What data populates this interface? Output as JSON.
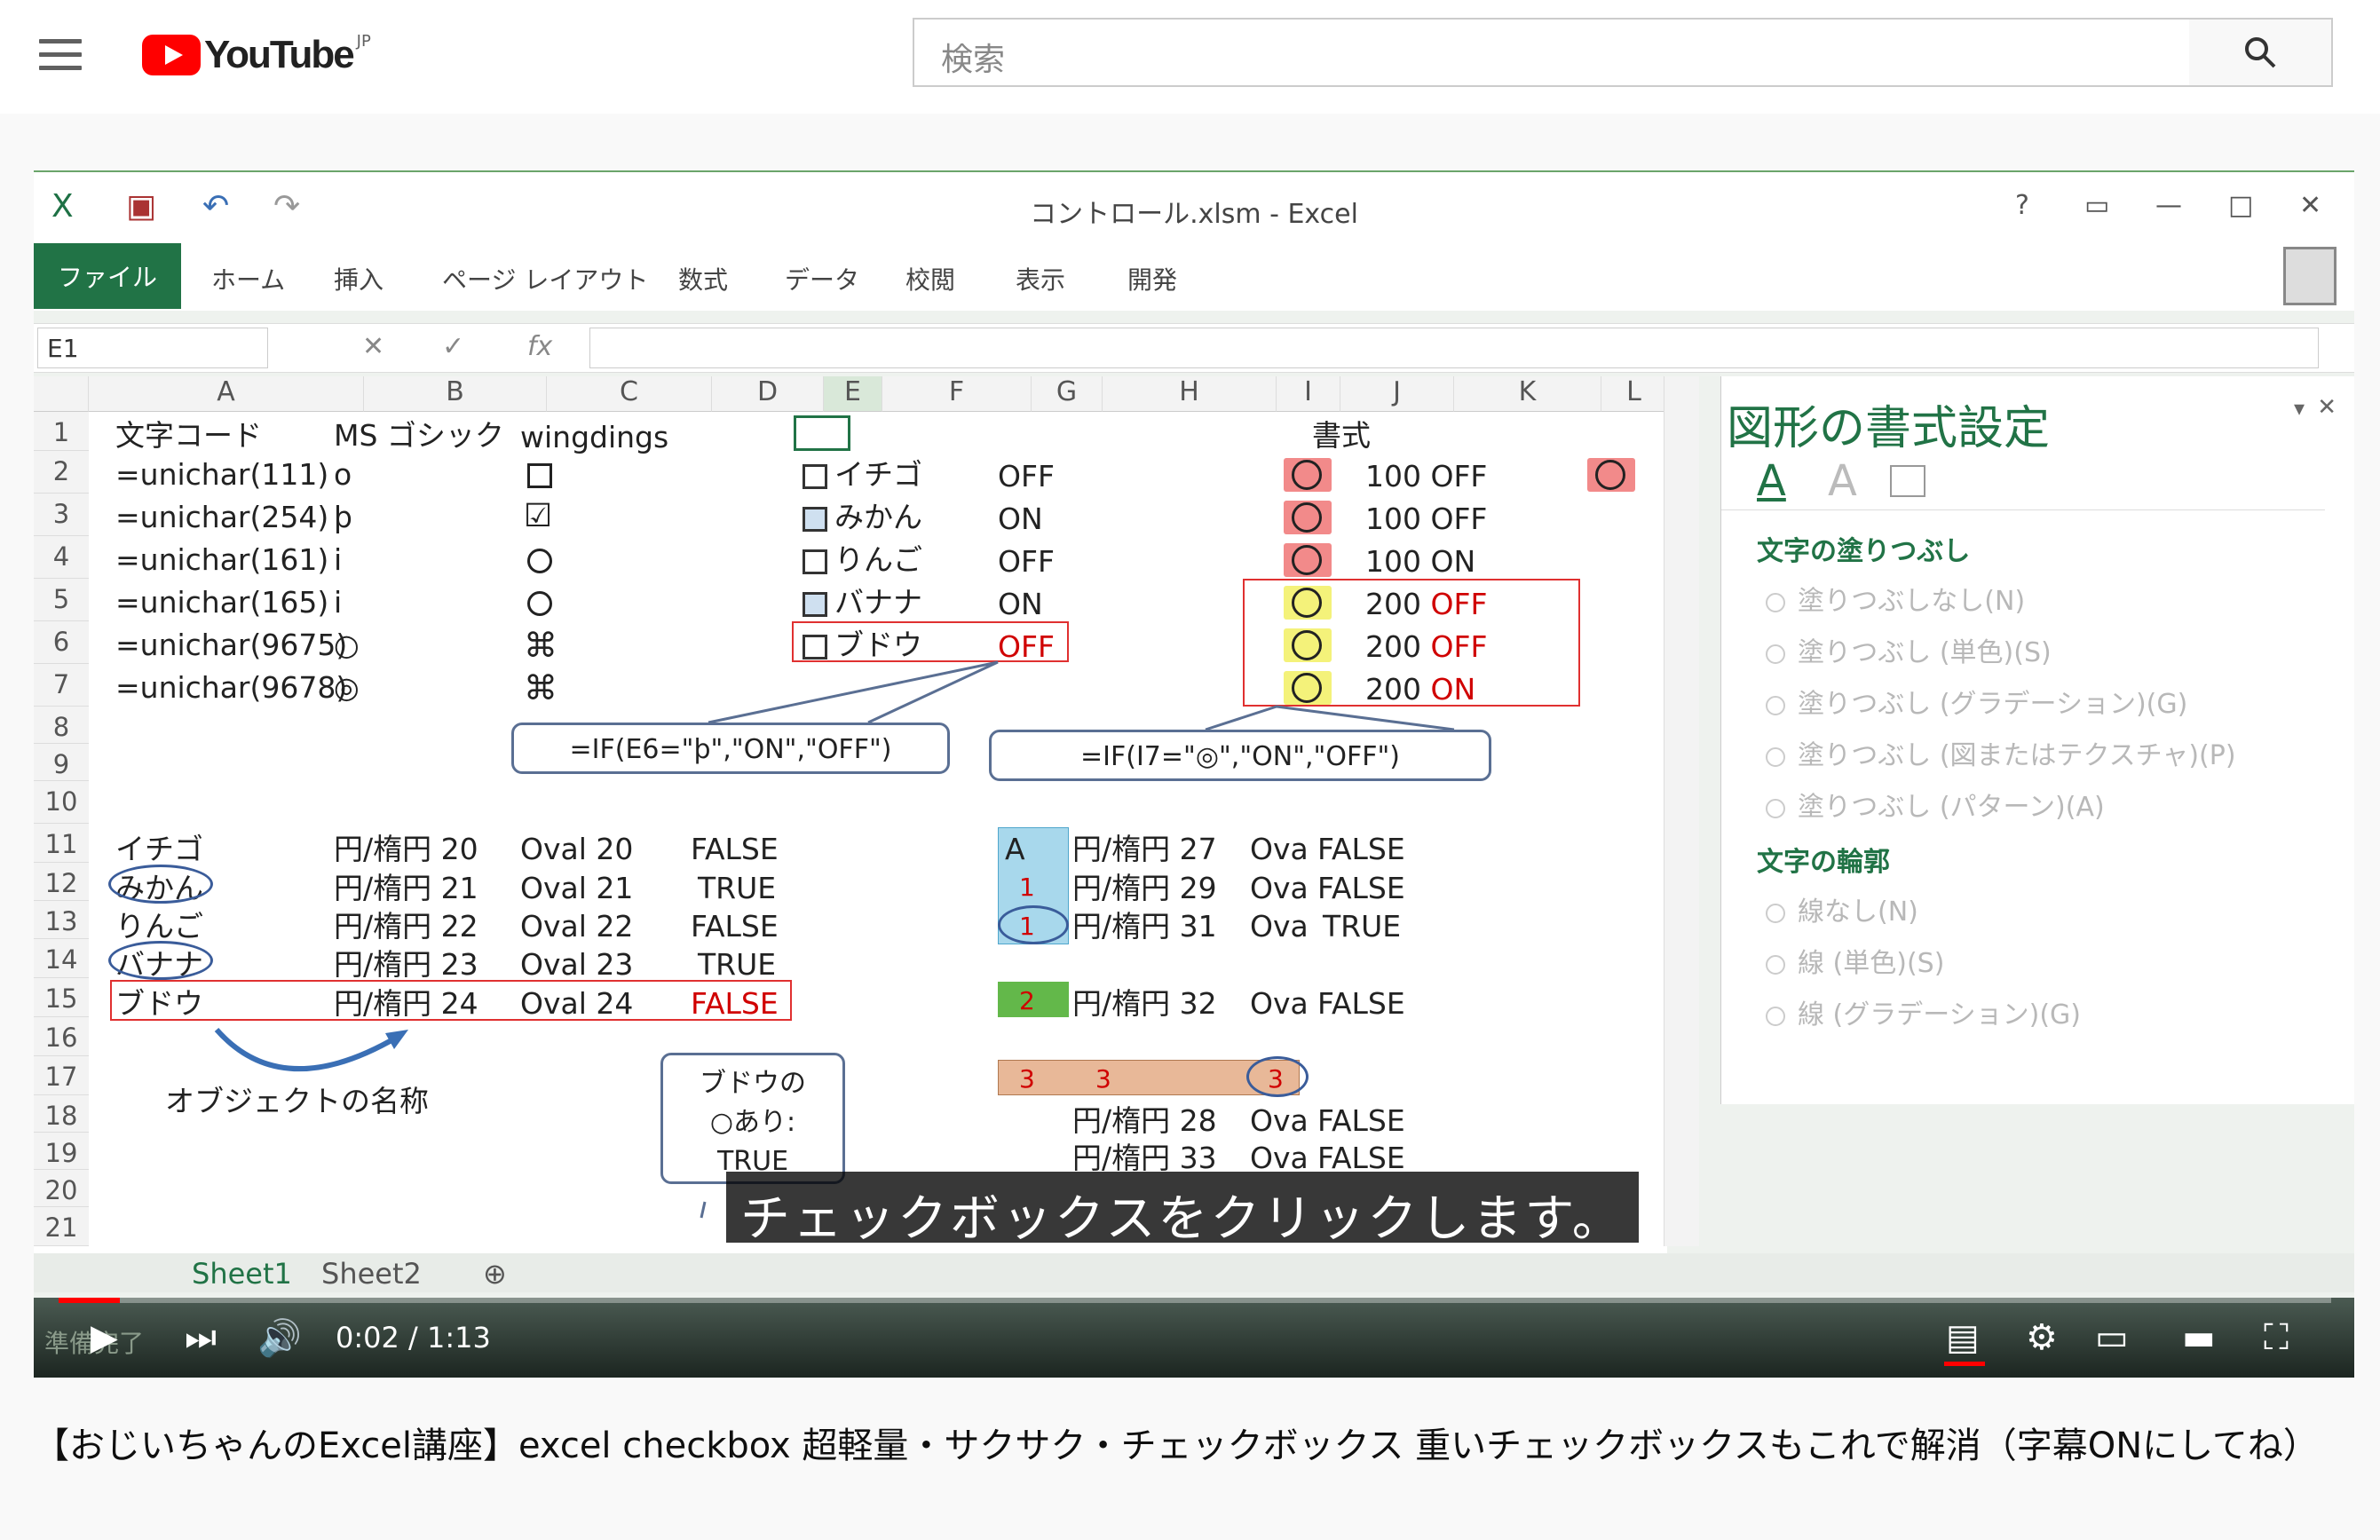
{
  "header": {
    "logo_text": "YouTube",
    "logo_region": "JP",
    "search_placeholder": "検索"
  },
  "excel": {
    "window_title": "コントロール.xlsm - Excel",
    "ribbon_tabs": [
      "ファイル",
      "ホーム",
      "挿入",
      "ページ レイアウト",
      "数式",
      "データ",
      "校閲",
      "表示",
      "開発"
    ],
    "name_box": "E1",
    "fx_label": "fx",
    "columns": [
      "A",
      "B",
      "C",
      "D",
      "E",
      "F",
      "G",
      "H",
      "I",
      "J",
      "K",
      "L"
    ],
    "rows": [
      "1",
      "2",
      "3",
      "4",
      "5",
      "6",
      "7",
      "8",
      "9",
      "10",
      "11",
      "12",
      "13",
      "14",
      "15",
      "16",
      "17",
      "18",
      "19",
      "20",
      "21"
    ],
    "cells": {
      "a1": "文字コード",
      "b1": "MS ゴシック",
      "c1": "wingdings",
      "j1": "書式",
      "a2": "=unichar(111)",
      "b2": "o",
      "a3": "=unichar(254)",
      "b3": "þ",
      "a4": "=unichar(161)",
      "b4": "i",
      "a5": "=unichar(165)",
      "b5": "i",
      "a6": "=unichar(9675)",
      "b6": "○",
      "a7": "=unichar(9678)",
      "b7": "◎",
      "f2": "イチゴ",
      "g2": "OFF",
      "f3": "みかん",
      "g3": "ON",
      "f4": "りんご",
      "g4": "OFF",
      "f5": "バナナ",
      "g5": "ON",
      "f6": "ブドウ",
      "g6": "OFF",
      "j2": "100 OFF",
      "j3": "100 OFF",
      "j4": "100 ON",
      "j5n": "200",
      "j5": "OFF",
      "j6n": "200",
      "j6": "OFF",
      "j7n": "200",
      "j7": "ON",
      "a11": "イチゴ",
      "b11": "円/楕円 20",
      "c11": "Oval 20",
      "d11": "FALSE",
      "a12": "みかん",
      "b12": "円/楕円 21",
      "c12": "Oval 21",
      "d12": "TRUE",
      "a13": "りんご",
      "b13": "円/楕円 22",
      "c13": "Oval 22",
      "d13": "FALSE",
      "a14": "バナナ",
      "b14": "円/楕円 23",
      "c14": "Oval 23",
      "d14": "TRUE",
      "a15": "ブドウ",
      "b15": "円/楕円 24",
      "c15": "Oval 24",
      "d15": "FALSE",
      "g11": "A",
      "h11": "円/楕円 27",
      "i11": "Ova",
      "j11": "FALSE",
      "g12": "1",
      "h12": "円/楕円 29",
      "i12": "Ova",
      "j12": "FALSE",
      "g13": "1",
      "h13": "円/楕円 31",
      "i13": "Ova",
      "j13": "TRUE",
      "g15": "2",
      "h15": "円/楕円 32",
      "i15": "Ova",
      "j15": "FALSE",
      "g17": "3",
      "h17": "3",
      "i17": "3",
      "h18": "円/楕円 28",
      "i18": "Ova",
      "j18": "FALSE",
      "h19": "円/楕円 33",
      "i19": "Ova",
      "j19": "FALSE",
      "a17": "オブジェクトの名称"
    },
    "callout1": "=IF(E6=\"þ\",\"ON\",\"OFF\")",
    "callout2": "=IF(I7=\"◎\",\"ON\",\"OFF\")",
    "callout3_line1": "ブドウの",
    "callout3_line2": "○あり:",
    "callout3_line3": "TRUE",
    "pane": {
      "title": "図形の書式設定",
      "section_fill": "文字の塗りつぶし",
      "fill_options": [
        "塗りつぶしなし(N)",
        "塗りつぶし (単色)(S)",
        "塗りつぶし (グラデーション)(G)",
        "塗りつぶし (図またはテクスチャ)(P)",
        "塗りつぶし (パターン)(A)"
      ],
      "section_outline": "文字の輪郭",
      "outline_options": [
        "線なし(N)",
        "線 (単色)(S)",
        "線 (グラデーション)(G)"
      ]
    },
    "sheet_tabs": [
      "Sheet1",
      "Sheet2"
    ],
    "status": "準備完了"
  },
  "player": {
    "subtitle": "チェックボックスをクリックします。",
    "time": "0:02 / 1:13",
    "progress_fraction": 0.027
  },
  "video_title": "【おじいちゃんのExcel講座】excel checkbox 超軽量・サクサク・チェックボックス 重いチェックボックスもこれで解消（字幕ONにしてね）"
}
